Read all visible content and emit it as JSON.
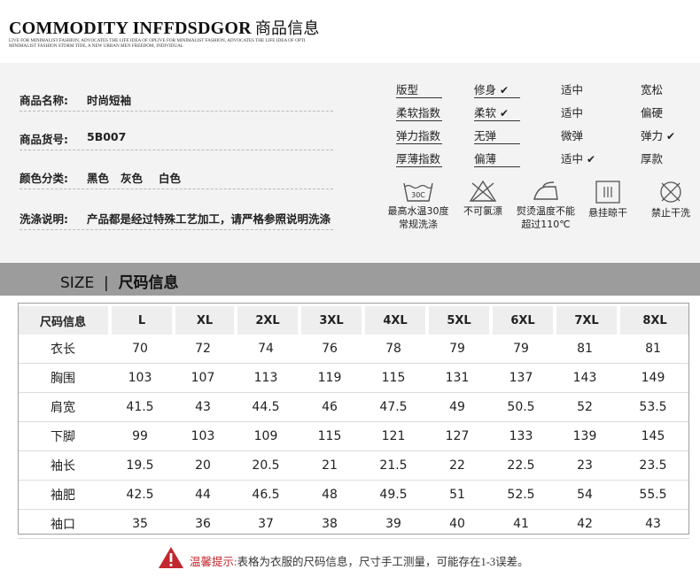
{
  "header": {
    "brand": "COMMODITY INFFDSDGOR",
    "brand_cn": "商品信息",
    "tagline": "LIVE FOR MINIMALIST FASHION, ADVOCATES THE LIFE IDEA OF OPLIVE FOR MINIMALIST FASHION, ADVOCATES THE LIFE IDEA OF OPTI MINIMALIST FASHION STORM TIDE, A NEW URBAN MEN FREEDOM, INDIVIDUAL"
  },
  "product": {
    "name_label": "商品名称:",
    "name_value": "时尚短袖",
    "sku_label": "商品货号:",
    "sku_value": "5B007",
    "color_label": "颜色分类:",
    "colors": [
      "黑色",
      "灰色",
      "白色"
    ],
    "wash_label": "洗涤说明:",
    "wash_value": "产品都是经过特殊工艺加工，请严格参照说明洗涤"
  },
  "attributes": [
    {
      "name": "版型",
      "options": [
        "修身",
        "适中",
        "宽松"
      ],
      "selected": 0
    },
    {
      "name": "柔软指数",
      "options": [
        "柔软",
        "适中",
        "偏硬"
      ],
      "selected": 0
    },
    {
      "name": "弹力指数",
      "options": [
        "无弹",
        "微弹",
        "弹力"
      ],
      "selected": 2
    },
    {
      "name": "厚薄指数",
      "options": [
        "偏薄",
        "适中",
        "厚款"
      ],
      "selected": 1
    }
  ],
  "care": [
    {
      "icon": "wash-30-icon",
      "line1": "最高水温30度",
      "line2": "常规洗涤",
      "badge": "30C"
    },
    {
      "icon": "no-bleach-icon",
      "line1": "不可氯漂",
      "line2": ""
    },
    {
      "icon": "iron-icon",
      "line1": "熨烫温度不能",
      "line2": "超过110℃"
    },
    {
      "icon": "hang-dry-icon",
      "line1": "悬挂晾干",
      "line2": ""
    },
    {
      "icon": "no-tumble-dry-icon",
      "line1": "禁止干洗",
      "line2": ""
    }
  ],
  "size_bar": {
    "en": "SIZE",
    "sep": "|",
    "cn": "尺码信息"
  },
  "size_table": {
    "header": [
      "尺码信息",
      "L",
      "XL",
      "2XL",
      "3XL",
      "4XL",
      "5XL",
      "6XL",
      "7XL",
      "8XL"
    ],
    "rows": [
      [
        "衣长",
        "70",
        "72",
        "74",
        "76",
        "78",
        "79",
        "79",
        "81",
        "81"
      ],
      [
        "胸围",
        "103",
        "107",
        "113",
        "119",
        "115",
        "131",
        "137",
        "143",
        "149"
      ],
      [
        "肩宽",
        "41.5",
        "43",
        "44.5",
        "46",
        "47.5",
        "49",
        "50.5",
        "52",
        "53.5"
      ],
      [
        "下脚",
        "99",
        "103",
        "109",
        "115",
        "121",
        "127",
        "133",
        "139",
        "145"
      ],
      [
        "袖长",
        "19.5",
        "20",
        "20.5",
        "21",
        "21.5",
        "22",
        "22.5",
        "23",
        "23.5"
      ],
      [
        "袖肥",
        "42.5",
        "44",
        "46.5",
        "48",
        "49.5",
        "51",
        "52.5",
        "54",
        "55.5"
      ],
      [
        "袖口",
        "35",
        "36",
        "37",
        "38",
        "39",
        "40",
        "41",
        "42",
        "43"
      ]
    ]
  },
  "notice": {
    "label": "温馨提示:",
    "text": "表格为衣服的尺码信息，尺寸手工测量，可能存在1-3误差。"
  },
  "colors": {
    "accent_red": "#c1272d",
    "bar_gray": "#9c9c9c",
    "panel_gray": "#f3f3f3"
  }
}
